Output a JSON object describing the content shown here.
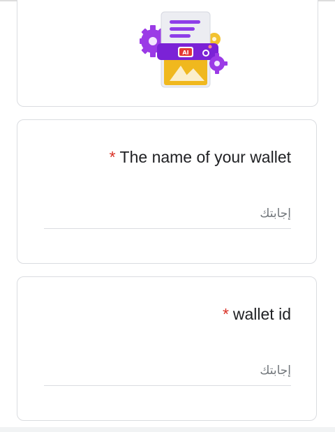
{
  "header": {
    "logo_icon": "ai-document-gears-icon",
    "logo_badge_text": "AI"
  },
  "questions": [
    {
      "required_mark": "*",
      "label": "The name of your wallet",
      "placeholder": "إجابتك",
      "value": ""
    },
    {
      "required_mark": "*",
      "label": "wallet id",
      "placeholder": "إجابتك",
      "value": ""
    }
  ],
  "colors": {
    "required": "#d93025",
    "border": "#dadce0",
    "logo_purple": "#8a2be2",
    "logo_yellow": "#f2b920"
  }
}
